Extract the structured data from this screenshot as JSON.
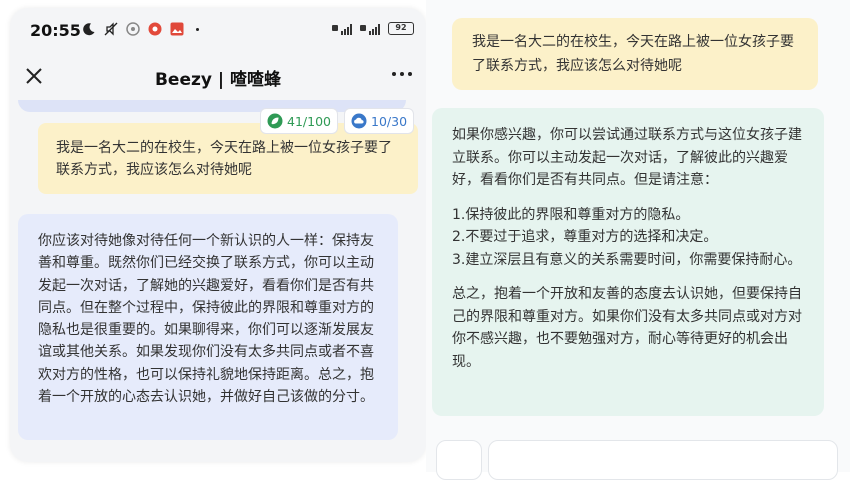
{
  "status_bar": {
    "time": "20:55",
    "battery": "92"
  },
  "nav": {
    "title": "Beezy | 喳喳蜂"
  },
  "badges": {
    "green": "41/100",
    "blue": "10/30"
  },
  "left_chat": {
    "question": "我是一名大二的在校生，今天在路上被一位女孩子要了联系方式，我应该怎么对待她呢",
    "answer": "你应该对待她像对待任何一个新认识的人一样：保持友善和尊重。既然你们已经交换了联系方式，你可以主动发起一次对话，了解她的兴趣爱好，看看你们是否有共同点。但在整个过程中，保持彼此的界限和尊重对方的隐私也是很重要的。如果聊得来，你们可以逐渐发展友谊或其他关系。如果发现你们没有太多共同点或者不喜欢对方的性格，也可以保持礼貌地保持距离。总之，抱着一个开放的心态去认识她，并做好自己该做的分寸。"
  },
  "right_chat": {
    "question": "我是一名大二的在校生，今天在路上被一位女孩子要了联系方式，我应该怎么对待她呢",
    "answer_intro": "如果你感兴趣，你可以尝试通过联系方式与这位女孩子建立联系。你可以主动发起一次对话，了解彼此的兴趣爱好，看看你们是否有共同点。但是请注意：",
    "answer_points": [
      "1.保持彼此的界限和尊重对方的隐私。",
      "2.不要过于追求，尊重对方的选择和决定。",
      "3.建立深层且有意义的关系需要时间，你需要保持耐心。"
    ],
    "answer_outro": "总之，抱着一个开放和友善的态度去认识她，但要保持自己的界限和尊重对方。如果你们没有太多共同点或对方对你不感兴趣，也不要勉强对方，耐心等待更好的机会出现。"
  },
  "colors": {
    "question_bubble": "#fcf1c9",
    "answer_left": "#e6ebfb",
    "answer_right": "#e6f4ef",
    "green_badge": "#2f9a55",
    "blue_badge": "#3a78c9"
  }
}
